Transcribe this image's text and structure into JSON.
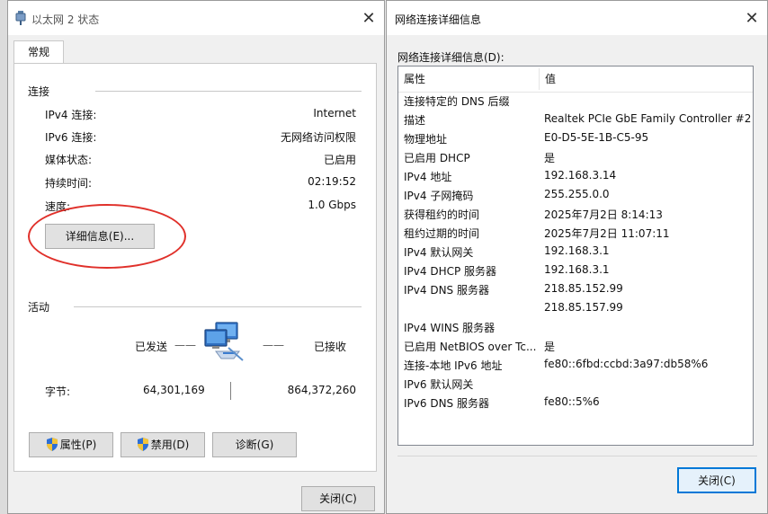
{
  "status_window": {
    "title": "以太网 2 状态",
    "close_glyph": "✕",
    "tab": "常规",
    "connection": {
      "group_label": "连接",
      "rows": [
        {
          "label": "IPv4 连接:",
          "value": "Internet"
        },
        {
          "label": "IPv6 连接:",
          "value": "无网络访问权限"
        },
        {
          "label": "媒体状态:",
          "value": "已启用"
        },
        {
          "label": "持续时间:",
          "value": "02:19:52"
        },
        {
          "label": "速度:",
          "value": "1.0 Gbps"
        }
      ],
      "details_button": "详细信息(E)..."
    },
    "activity": {
      "group_label": "活动",
      "sent_label": "已发送",
      "dash": "——",
      "received_label": "已接收",
      "bytes_label": "字节:",
      "bytes_sent": "64,301,169",
      "bytes_received": "864,372,260"
    },
    "buttons": {
      "properties": "属性(P)",
      "disable": "禁用(D)",
      "diagnose": "诊断(G)",
      "close": "关闭(C)"
    }
  },
  "details_window": {
    "title": "网络连接详细信息",
    "close_glyph": "✕",
    "list_label": "网络连接详细信息(D):",
    "columns": {
      "property": "属性",
      "value": "值"
    },
    "rows": [
      {
        "property": "连接特定的 DNS 后缀",
        "value": ""
      },
      {
        "property": "描述",
        "value": "Realtek PCIe GbE Family Controller #2"
      },
      {
        "property": "物理地址",
        "value": "E0-D5-5E-1B-C5-95"
      },
      {
        "property": "已启用 DHCP",
        "value": "是"
      },
      {
        "property": "IPv4 地址",
        "value": "192.168.3.14"
      },
      {
        "property": "IPv4 子网掩码",
        "value": "255.255.0.0"
      },
      {
        "property": "获得租约的时间",
        "value": "2025年7月2日 8:14:13"
      },
      {
        "property": "租约过期的时间",
        "value": "2025年7月2日 11:07:11"
      },
      {
        "property": "IPv4 默认网关",
        "value": "192.168.3.1"
      },
      {
        "property": "IPv4 DHCP 服务器",
        "value": "192.168.3.1"
      },
      {
        "property": "IPv4 DNS 服务器",
        "value": "218.85.152.99"
      },
      {
        "property": "",
        "value": "218.85.157.99"
      },
      {
        "property": "IPv4 WINS 服务器",
        "value": ""
      },
      {
        "property": "已启用 NetBIOS over Tc...",
        "value": "是"
      },
      {
        "property": "连接-本地 IPv6 地址",
        "value": "fe80::6fbd:ccbd:3a97:db58%6"
      },
      {
        "property": "IPv6 默认网关",
        "value": ""
      },
      {
        "property": "IPv6 DNS 服务器",
        "value": "fe80::5%6"
      }
    ],
    "close_button": "关闭(C)"
  },
  "colors": {
    "highlight_ring": "#e0302a",
    "button_focus": "#0078d7"
  },
  "icons": [
    "network-adapter-icon",
    "shield-icon",
    "network-computers-icon"
  ]
}
